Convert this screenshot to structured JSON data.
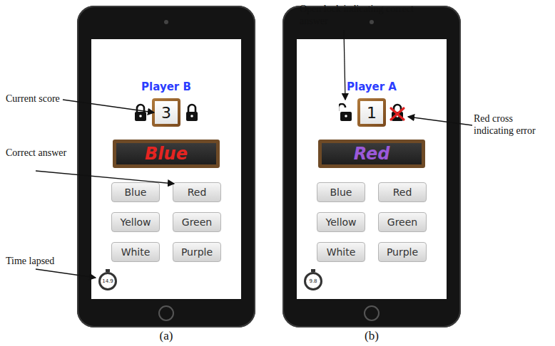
{
  "panels": [
    {
      "caption": "(a)",
      "player": "Player B",
      "score": "3",
      "locks": [
        {
          "open": false,
          "error": false
        },
        {
          "open": false,
          "error": false
        }
      ],
      "word": {
        "text": "Blue",
        "color": "#e52421"
      },
      "buttons": [
        "Blue",
        "Red",
        "Yellow",
        "Green",
        "White",
        "Purple"
      ],
      "timer": "14.9",
      "annotations": [
        {
          "kind": "score",
          "text": "Current score"
        },
        {
          "kind": "answer",
          "text": "Correct answer"
        },
        {
          "kind": "timer",
          "text": "Time lapsed"
        }
      ]
    },
    {
      "caption": "(b)",
      "player": "Player A",
      "score": "1",
      "locks": [
        {
          "open": true,
          "error": false
        },
        {
          "open": false,
          "error": true
        }
      ],
      "word": {
        "text": "Red",
        "color": "#9b59d9"
      },
      "buttons": [
        "Blue",
        "Red",
        "Yellow",
        "Green",
        "White",
        "Purple"
      ],
      "timer": "9.8",
      "annotations": [
        {
          "kind": "lock",
          "text": "Open lock indicating correct answer"
        },
        {
          "kind": "cross",
          "text": "Red cross indicating error"
        }
      ]
    }
  ]
}
